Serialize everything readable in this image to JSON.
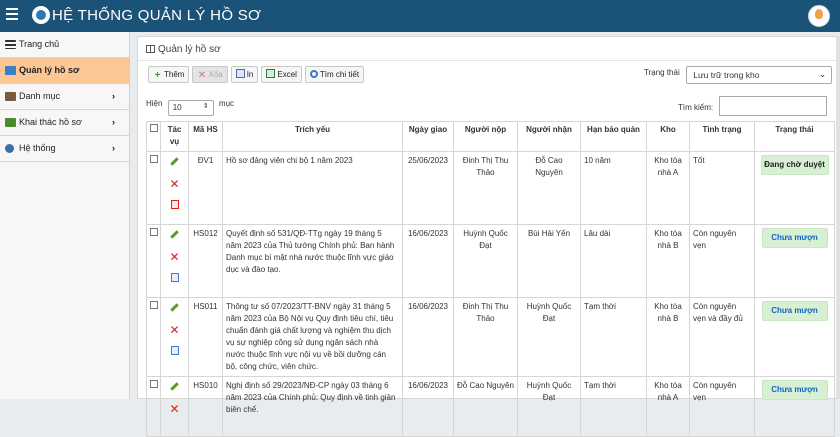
{
  "app": {
    "title": "HỆ THỐNG QUẢN LÝ HỒ SƠ"
  },
  "sidebar": {
    "items": [
      {
        "label": "Trang chủ",
        "icon": "menu-icon"
      },
      {
        "label": "Quản lý hồ sơ",
        "icon": "inbox-icon",
        "active": true
      },
      {
        "label": "Danh mục",
        "icon": "list-icon",
        "chevron": "›"
      },
      {
        "label": "Khai thác hồ sơ",
        "icon": "book-icon",
        "chevron": "›"
      },
      {
        "label": "Hệ thống",
        "icon": "gear-icon",
        "chevron": "›"
      }
    ]
  },
  "panel": {
    "title": "Quản lý hồ sơ"
  },
  "toolbar": {
    "add": "Thêm",
    "delete": "Xóa",
    "print": "In",
    "excel": "Excel",
    "detail_search": "Tìm chi tiết"
  },
  "status_filter": {
    "label": "Trạng thái",
    "value": "Lưu trữ trong kho"
  },
  "length": {
    "prefix": "Hiện",
    "value": "10",
    "suffix": "mục"
  },
  "search": {
    "label": "Tìm kiếm:",
    "value": ""
  },
  "table": {
    "headers": [
      "Tác vụ",
      "Mã HS",
      "Trích yếu",
      "Ngày giao",
      "Người nộp",
      "Người nhận",
      "Hạn bảo quản",
      "Kho",
      "Tình trạng",
      "Trạng thái"
    ],
    "rows": [
      {
        "code": "ĐV1",
        "summary": "Hồ sơ đảng viên chi bộ 1 năm 2023",
        "date": "25/06/2023",
        "submitter": "Đinh Thị Thu Thảo",
        "receiver": "Đỗ Cao Nguyên",
        "retention": "10 năm",
        "warehouse": "Kho tòa nhà A",
        "condition": "Tốt",
        "status": "Đang chờ duyệt"
      },
      {
        "code": "HS012",
        "summary": "Quyết định số 531/QĐ-TTg ngày 19 tháng 5 năm 2023 của Thủ tướng Chính phủ: Ban hành Danh mục bí mật nhà nước thuộc lĩnh vực giáo dục và đào tạo.",
        "date": "16/06/2023",
        "submitter": "Huỳnh Quốc Đạt",
        "receiver": "Bùi Hải Yến",
        "retention": "Lâu dài",
        "warehouse": "Kho tòa nhà B",
        "condition": "Còn nguyên vẹn",
        "status": "Chưa mượn"
      },
      {
        "code": "HS011",
        "summary": "Thông tư số 07/2023/TT-BNV ngày 31 tháng 5 năm 2023 của Bộ Nội vụ Quy định tiêu chí, tiêu chuẩn đánh giá chất lượng và nghiệm thu dịch vụ sự nghiệp công sử dụng ngân sách nhà nước thuộc lĩnh vực nội vụ về bồi dưỡng cán bộ, công chức, viên chức.",
        "date": "16/06/2023",
        "submitter": "Đinh Thị Thu Thảo",
        "receiver": "Huỳnh Quốc Đạt",
        "retention": "Tạm thời",
        "warehouse": "Kho tòa nhà B",
        "condition": "Còn nguyên vẹn và đầy đủ",
        "status": "Chưa mượn"
      },
      {
        "code": "HS010",
        "summary": "Nghị định số 29/2023/NĐ-CP ngày 03 tháng 6 năm 2023 của Chính phủ: Quy định về tinh giản biên chế.",
        "date": "16/06/2023",
        "submitter": "Đỗ Cao Nguyên",
        "receiver": "Huỳnh Quốc Đạt",
        "retention": "Tạm thời",
        "warehouse": "Kho tòa nhà A",
        "condition": "Còn nguyên vẹn",
        "status": "Chưa mượn"
      }
    ]
  }
}
